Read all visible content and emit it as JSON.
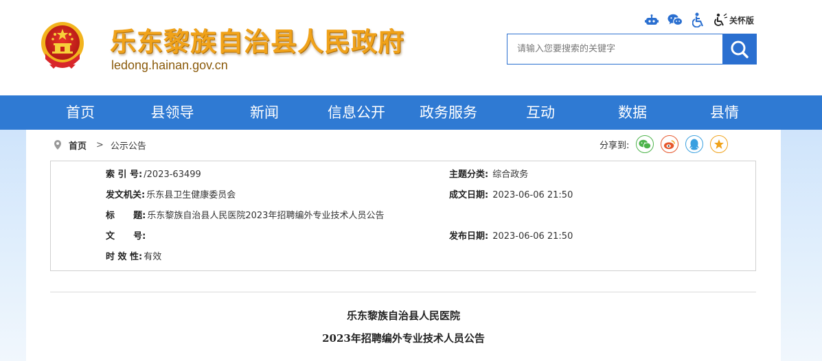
{
  "header": {
    "site_title": "乐东黎族自治县人民政府",
    "site_domain": "ledong.hainan.gov.cn",
    "tools": [
      {
        "icon": "robot-icon"
      },
      {
        "icon": "wechat-icon"
      },
      {
        "icon": "accessibility-icon"
      }
    ],
    "care_label": "关怀版",
    "search": {
      "placeholder": "请输入您要搜索的关键字",
      "value": ""
    }
  },
  "nav": {
    "items": [
      "首页",
      "县领导",
      "新闻",
      "信息公开",
      "政务服务",
      "互动",
      "数据",
      "县情"
    ]
  },
  "breadcrumb": {
    "home": "首页",
    "separator": ">",
    "current": "公示公告"
  },
  "share": {
    "label": "分享到:",
    "targets": [
      {
        "icon": "wechat-icon",
        "color": "#4cb34a"
      },
      {
        "icon": "weibo-icon",
        "color": "#e6572c"
      },
      {
        "icon": "qq-icon",
        "color": "#3aa0e0"
      },
      {
        "icon": "favorite-star-icon",
        "color": "#f0a21a"
      }
    ]
  },
  "meta": {
    "index_label": "索 引 号:",
    "index_value": "/2023-63499",
    "topic_label": "主题分类:",
    "topic_value": "综合政务",
    "issuer_label": "发文机关:",
    "issuer_value": "乐东县卫生健康委员会",
    "date_label": "成文日期:",
    "date_value": "2023-06-06 21:50",
    "title_label": "标      题:",
    "title_value": "乐东黎族自治县人民医院2023年招聘编外专业技术人员公告",
    "docno_label": "文      号:",
    "docno_value": "",
    "pubdate_label": "发布日期:",
    "pubdate_value": "2023-06-06 21:50",
    "validity_label": "时 效 性:",
    "validity_value": "有效"
  },
  "article": {
    "title_line1": "乐东黎族自治县人民医院",
    "title_line2": "2023年招聘编外专业技术人员公告"
  },
  "colors": {
    "brand_blue": "#2f7ad3",
    "title_gold": "#f0a21a",
    "domain_brown": "#8a5a0a"
  }
}
